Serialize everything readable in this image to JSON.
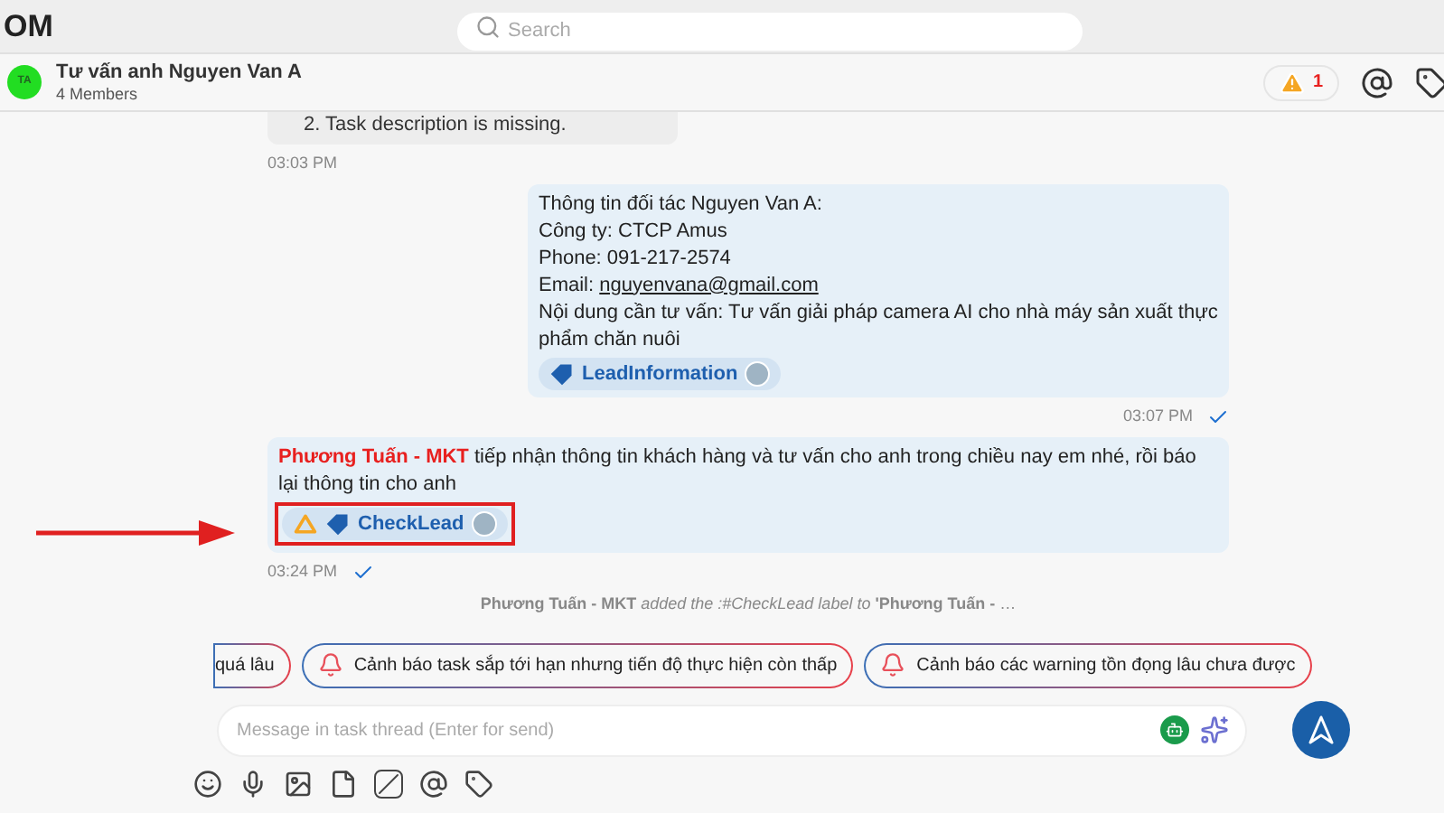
{
  "app_title": "OM",
  "search": {
    "placeholder": "Search"
  },
  "conversation": {
    "avatar_initials": "TA",
    "title": "Tư vấn anh Nguyen Van A",
    "members": "4 Members",
    "alert_count": "1"
  },
  "messages": [
    {
      "kind": "plain",
      "mine": false,
      "lines": [
        "2. Task description is missing."
      ],
      "time": "03:03 PM",
      "sent": false
    },
    {
      "kind": "lead",
      "mine": true,
      "lines": [
        "Thông tin đối tác Nguyen Van A:",
        "Công ty: CTCP Amus",
        "Phone: 091-217-2574",
        {
          "label": "Email:",
          "link": "nguyenvana@gmail.com"
        },
        "Nội dung cần tư vấn: Tư vấn giải pháp camera AI cho nhà máy sản xuất thực phẩm chăn nuôi"
      ],
      "tag": {
        "label": "LeadInformation",
        "highlighted": false,
        "pending": false
      },
      "time": "03:07 PM",
      "sent": true
    },
    {
      "kind": "mention",
      "mine": false,
      "mention": "Phương Tuấn - MKT",
      "text": "tiếp nhận thông tin khách hàng và tư vấn cho anh trong chiều nay em nhé, rồi báo lại thông tin cho anh",
      "tag": {
        "label": "CheckLead",
        "highlighted": true,
        "pending": true
      },
      "time": "03:24 PM",
      "sent": true
    }
  ],
  "system_note": "**Phương Tuấn - MKT** *added the :#CheckLead label to* **'Phương Tuấn -** …",
  "suggestions": [
    {
      "label": "quá lâu",
      "cut": true
    },
    {
      "label": "Cảnh báo task sắp tới hạn nhưng tiến độ thực hiện còn thấp",
      "cut": false
    },
    {
      "label": "Cảnh báo các warning tồn đọng lâu chưa được",
      "cut": false
    }
  ],
  "composer": {
    "placeholder": "Message in task thread (Enter for send)"
  },
  "toolbar": [
    {
      "kind": "emoji"
    },
    {
      "kind": "mic"
    },
    {
      "kind": "image"
    },
    {
      "kind": "file"
    },
    {
      "kind": "slash"
    },
    {
      "kind": "at"
    },
    {
      "kind": "tag"
    }
  ]
}
